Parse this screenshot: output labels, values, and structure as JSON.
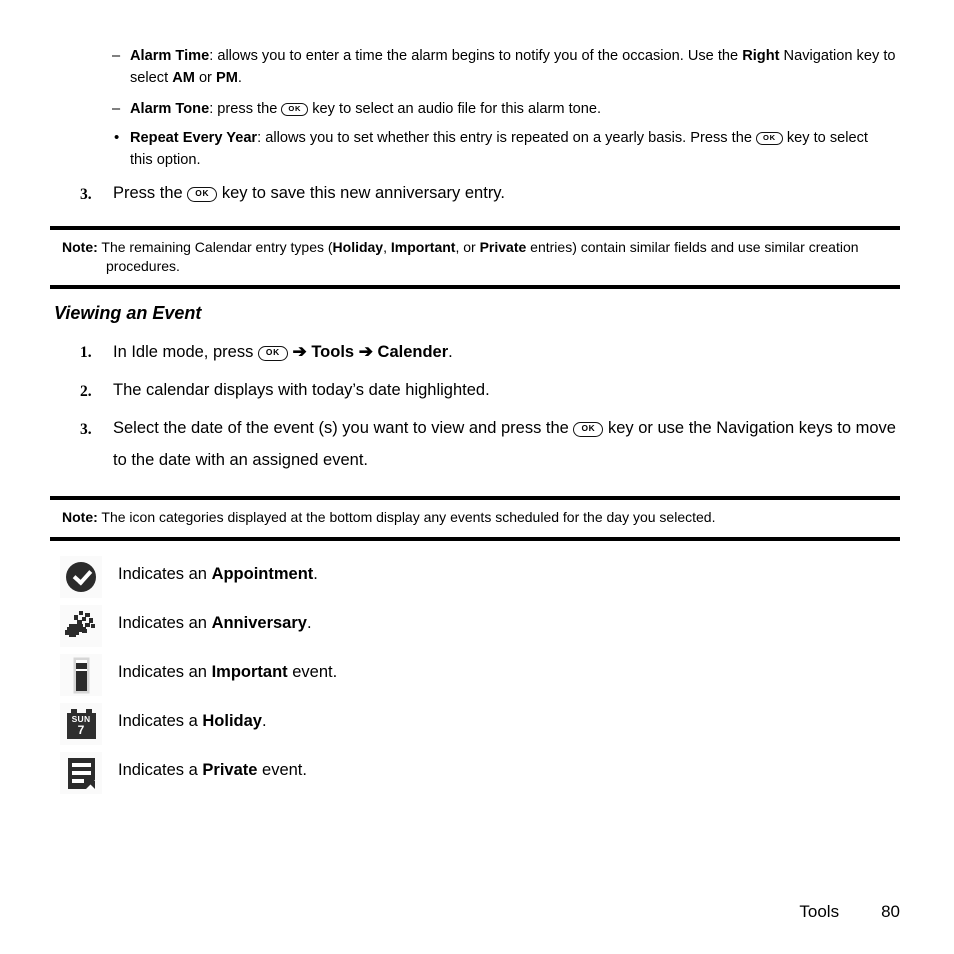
{
  "page": {
    "footer_section": "Tools",
    "footer_page_number": "80",
    "ok_key_label": "OK",
    "arrow_glyph": "➔",
    "dash_glyph": "–",
    "bullet_glyph": "•"
  },
  "sub_bullets": [
    {
      "marker": "–",
      "term": "Alarm Time",
      "text_1": ": allows you to enter a time the alarm begins to notify you of the occasion. Use the ",
      "bold_mid": "Right",
      "text_2": " Navigation key to select ",
      "bold_am": "AM",
      "text_3": " or ",
      "bold_pm": "PM",
      "text_4": "."
    },
    {
      "marker": "–",
      "term": "Alarm Tone",
      "text_1": ": press the ",
      "text_2": " key to select an audio file for this alarm tone."
    }
  ],
  "main_bullet": {
    "marker": "•",
    "term": "Repeat Every Year",
    "text_1": ": allows you to set whether this entry is repeated on a yearly basis. Press the ",
    "text_2": " key to select this option."
  },
  "step_3_top": {
    "number": "3.",
    "text_1": "Press the ",
    "text_2": " key to save this new anniversary entry."
  },
  "note_1": {
    "label": "Note:",
    "text_1": " The remaining Calendar entry types (",
    "bold_1": "Holiday",
    "text_2": ", ",
    "bold_2": "Important",
    "text_3": ", or ",
    "bold_3": "Private",
    "text_4": " entries) contain similar fields and use similar creation",
    "continuation": "procedures."
  },
  "section": {
    "heading": "Viewing an Event",
    "steps": [
      {
        "number": "1.",
        "text_1": "In Idle mode, press ",
        "arrow_1": "➔",
        "bold_1": "Tools",
        "arrow_2": "➔",
        "bold_2": "Calender",
        "text_2": "."
      },
      {
        "number": "2.",
        "text_1": "The calendar displays with today’s date highlighted."
      },
      {
        "number": "3.",
        "text_1": "Select the date of the event (s) you want to view and press the ",
        "text_2": " key or use the Navigation keys to move to the date with an assigned event."
      }
    ]
  },
  "note_2": {
    "label": "Note:",
    "text_1": " The icon categories displayed at the bottom display any events scheduled for the day you selected."
  },
  "legend": {
    "rows": [
      {
        "icon": "appointment-icon",
        "text_1": "Indicates an ",
        "bold": "Appointment",
        "text_2": "."
      },
      {
        "icon": "anniversary-icon",
        "text_1": "Indicates an ",
        "bold": "Anniversary",
        "text_2": "."
      },
      {
        "icon": "important-icon",
        "text_1": "Indicates an ",
        "bold": "Important",
        "text_2": " event."
      },
      {
        "icon": "holiday-icon",
        "text_1": "Indicates a ",
        "bold": "Holiday",
        "text_2": ".",
        "calendar_day_label": "SUN",
        "calendar_day_number": "7"
      },
      {
        "icon": "private-icon",
        "text_1": "Indicates a ",
        "bold": "Private",
        "text_2": " event."
      }
    ]
  }
}
